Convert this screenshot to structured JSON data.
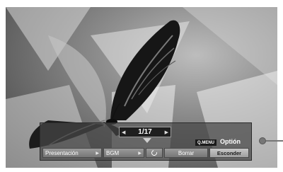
{
  "counter": {
    "value": "1/17",
    "prev_icon": "triangle-left-icon",
    "next_icon": "triangle-right-icon"
  },
  "qmenu": {
    "label": "Q.MENU"
  },
  "option": {
    "label": "Optión"
  },
  "buttons": {
    "presentacion": "Presentación",
    "bgm": "BGM",
    "rotate_icon": "rotate-icon",
    "borrar": "Borrar",
    "esconder": "Esconder"
  },
  "colors": {
    "osd_background": "#4a4a4a",
    "button_face": "#8a8a8a",
    "hide_button": "#bdbdbd",
    "text": "#ffffff"
  }
}
